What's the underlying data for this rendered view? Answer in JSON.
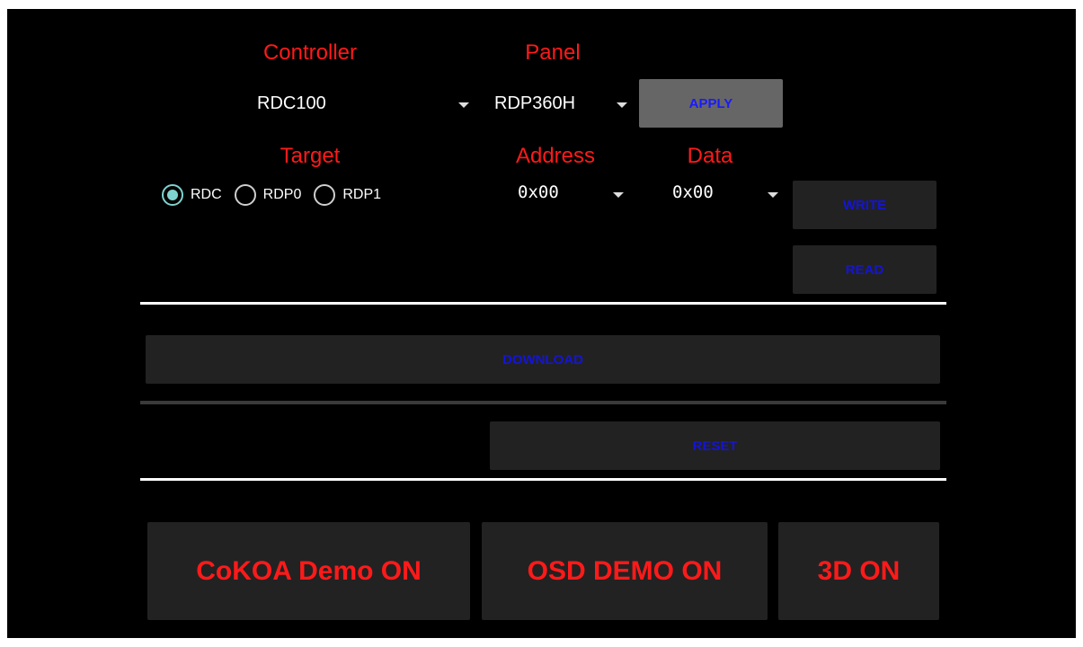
{
  "labels": {
    "controller": "Controller",
    "panel": "Panel",
    "target": "Target",
    "address": "Address",
    "data": "Data"
  },
  "controller_spinner": {
    "value": "RDC100"
  },
  "panel_spinner": {
    "value": "RDP360H"
  },
  "address_spinner": {
    "value": "0x00"
  },
  "data_spinner": {
    "value": "0x00"
  },
  "target_options": [
    {
      "label": "RDC",
      "checked": true
    },
    {
      "label": "RDP0",
      "checked": false
    },
    {
      "label": "RDP1",
      "checked": false
    }
  ],
  "buttons": {
    "apply": "APPLY",
    "write": "WRITE",
    "read": "READ",
    "download": "DOWNLOAD",
    "reset": "RESET",
    "cokoa": "CoKOA Demo ON",
    "osd": "OSD DEMO ON",
    "three_d": "3D ON"
  },
  "colors": {
    "background": "#000000",
    "label_red": "#ff1a1a",
    "button_text_blue": "#1a1aff",
    "radio_checked": "#7fd3cf",
    "button_bg": "#222222"
  },
  "icons": {
    "spinner_arrow": "triangle-down"
  }
}
